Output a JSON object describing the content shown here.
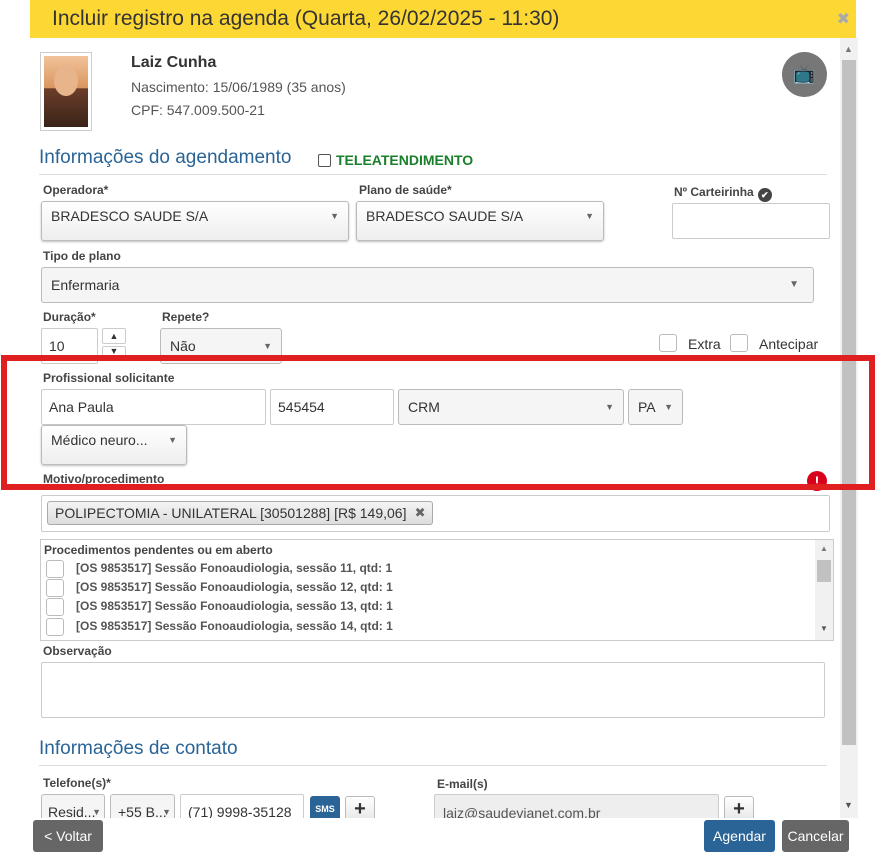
{
  "dialog": {
    "title": "Incluir registro na agenda (Quarta, 26/02/2025 - 11:30)",
    "close_glyph": "✖"
  },
  "patient": {
    "name": "Laiz Cunha",
    "birth": "Nascimento:  15/06/1989 (35 anos)",
    "cpf": "CPF:  547.009.500-21"
  },
  "scheduling": {
    "section_title": "Informações do agendamento",
    "teleatendimento_label": "TELEATENDIMENTO",
    "operadora_label": "Operadora*",
    "operadora_value": "BRADESCO SAUDE S/A",
    "plano_label": "Plano de saúde*",
    "plano_value": "BRADESCO SAUDE S/A",
    "carteirinha_label": "Nº Carteirinha",
    "carteirinha_value": "",
    "tipo_plano_label": "Tipo de plano",
    "tipo_plano_value": "Enfermaria",
    "duracao_label": "Duração*",
    "duracao_value": "10",
    "repete_label": "Repete?",
    "repete_value": "Não",
    "extra_label": "Extra",
    "antecipar_label": "Antecipar"
  },
  "professional": {
    "label": "Profissional solicitante",
    "name": "Ana Paula",
    "registry_number": "545454",
    "council": "CRM",
    "state": "PA",
    "specialty": "Médico neuro..."
  },
  "procedure": {
    "label": "Motivo/procedimento",
    "error_glyph": "!",
    "selected": "POLIPECTOMIA - UNILATERAL [30501288] [R$ 149,06]",
    "remove_glyph": "✖"
  },
  "pending": {
    "title": "Procedimentos pendentes ou em aberto",
    "items": [
      "[OS 9853517] Sessão Fonoaudiologia, sessão 11, qtd: 1",
      "[OS 9853517] Sessão Fonoaudiologia, sessão 12, qtd: 1",
      "[OS 9853517] Sessão Fonoaudiologia, sessão 13, qtd: 1",
      "[OS 9853517] Sessão Fonoaudiologia, sessão 14, qtd: 1"
    ]
  },
  "observation": {
    "label": "Observação",
    "value": ""
  },
  "contact": {
    "section_title": "Informações de contato",
    "phone_label": "Telefone(s)*",
    "phone_type": "Resid...",
    "phone_country": "+55 B...",
    "phone_number": "(71) 9998-35128",
    "sms_label": "SMS",
    "email_label": "E-mail(s)",
    "email_value": "laiz@saudevianet.com.br",
    "add_glyph": "+"
  },
  "footer": {
    "back_label": "< Voltar",
    "schedule_label": "Agendar",
    "cancel_label": "Cancelar"
  },
  "icons": {
    "arrow_down": "▼",
    "arrow_up": "▲",
    "check": "✔",
    "tv_device": "📺"
  },
  "colors": {
    "title_bar": "#fdd835",
    "section_blue": "#2a6496",
    "tele_green": "#1a7f2a",
    "highlight_red": "#e02020",
    "error_red": "#d9001b"
  }
}
